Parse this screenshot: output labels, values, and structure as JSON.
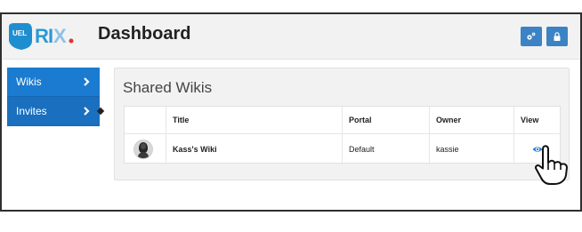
{
  "app": {
    "title": "Dashboard",
    "logo": {
      "name": "UEL",
      "brand": "RIX."
    }
  },
  "topbar": {
    "buttons": [
      {
        "icon": "gears-icon"
      },
      {
        "icon": "lock-icon"
      }
    ]
  },
  "sidebar": {
    "items": [
      {
        "label": "Wikis",
        "icon": "chevron-right-icon"
      },
      {
        "label": "Invites",
        "icon": "chevron-right-icon",
        "active": true
      }
    ]
  },
  "panel": {
    "title": "Shared Wikis",
    "table": {
      "columns": [
        "Title",
        "Portal",
        "Owner",
        "View"
      ],
      "rows": [
        {
          "title": "Kass's Wiki",
          "portal": "Default",
          "owner": "kassie",
          "view_icon": "eye-icon"
        }
      ]
    }
  },
  "colors": {
    "accent": "#1b7bd0",
    "button": "#3b83c4",
    "topbar_bg": "#f2f2f2",
    "panel_bg": "#f2f2f2"
  }
}
